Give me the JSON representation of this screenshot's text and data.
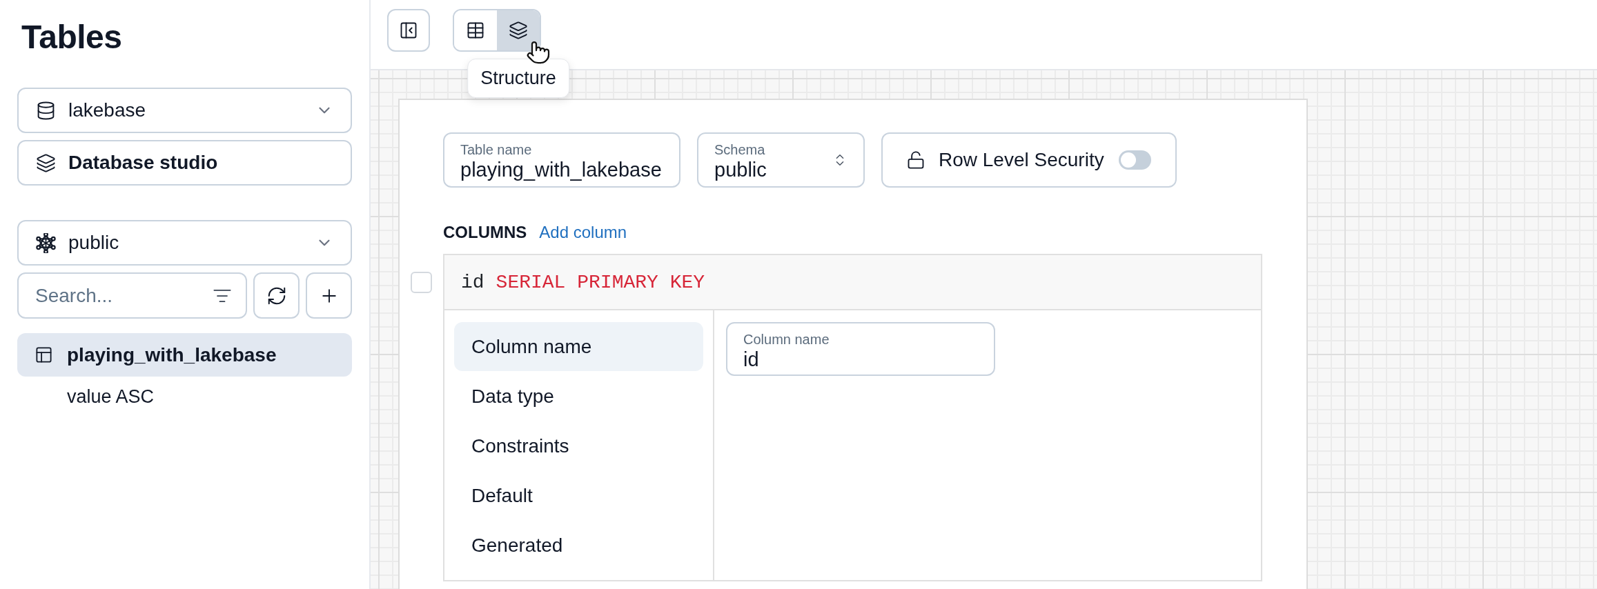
{
  "sidebar": {
    "title": "Tables",
    "database_select": {
      "value": "lakebase"
    },
    "studio_button": {
      "label": "Database studio"
    },
    "schema_select": {
      "value": "public"
    },
    "search": {
      "placeholder": "Search..."
    },
    "tables": [
      {
        "name": "playing_with_lakebase",
        "selected": true,
        "children": [
          {
            "name": "value ASC",
            "selected": false
          }
        ]
      }
    ]
  },
  "toolbar": {
    "views": [
      {
        "kind": "table",
        "selected": false
      },
      {
        "kind": "structure",
        "selected": true
      }
    ],
    "tooltip": "Structure"
  },
  "editor": {
    "table_name": {
      "label": "Table name",
      "value": "playing_with_lakebase"
    },
    "schema": {
      "label": "Schema",
      "value": "public"
    },
    "rls": {
      "label": "Row Level Security",
      "on": false
    },
    "columns_heading": "COLUMNS",
    "add_column": "Add column",
    "columns": [
      {
        "name": "id",
        "definition": "SERIAL PRIMARY KEY",
        "checked": false,
        "sections": [
          {
            "label": "Column name",
            "selected": true
          },
          {
            "label": "Data type",
            "selected": false
          },
          {
            "label": "Constraints",
            "selected": false
          },
          {
            "label": "Default",
            "selected": false
          },
          {
            "label": "Generated",
            "selected": false
          }
        ],
        "field": {
          "label": "Column name",
          "value": "id"
        }
      }
    ]
  }
}
